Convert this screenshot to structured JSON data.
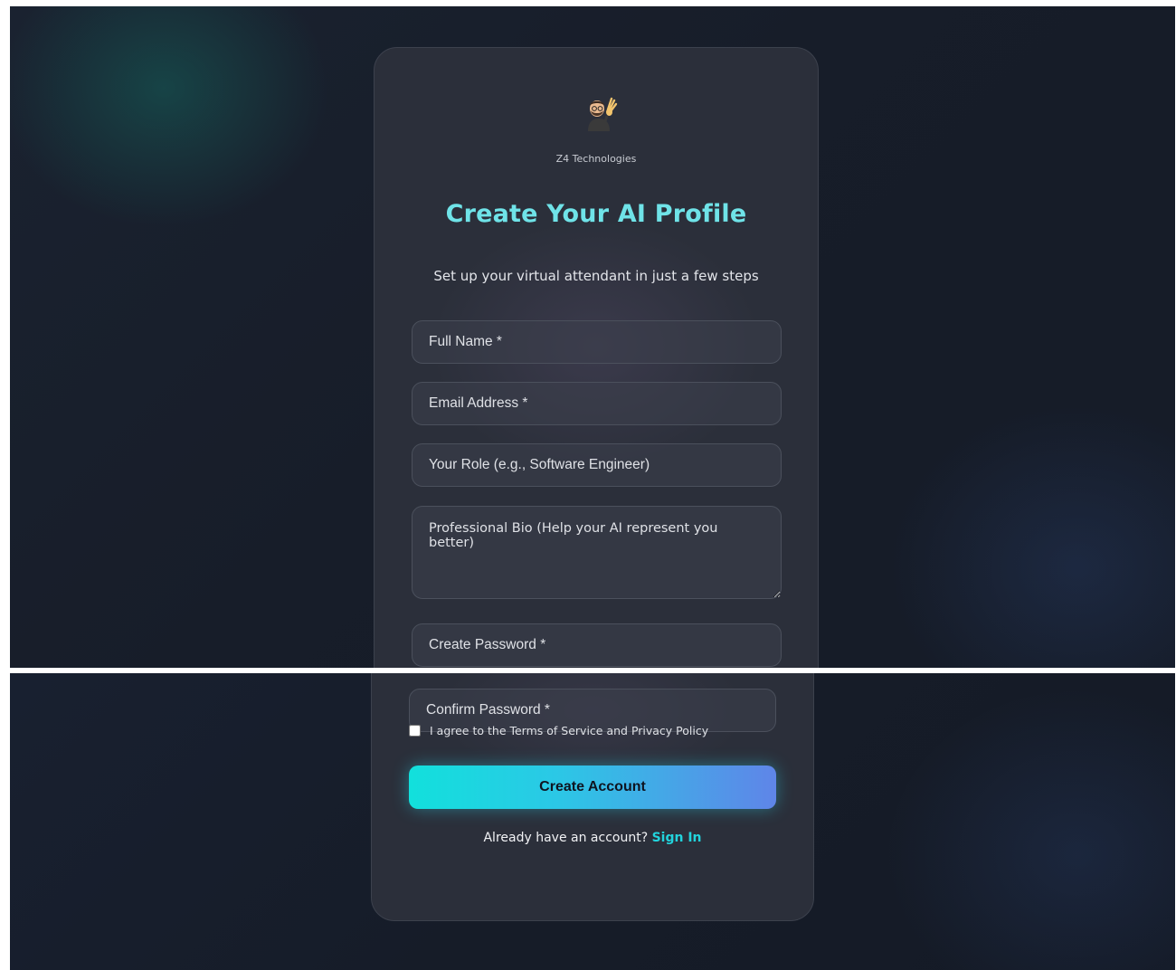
{
  "brand": {
    "company": "Z4 Technologies",
    "avatar_icon": "avatar-waving-icon"
  },
  "header": {
    "title": "Create Your AI Profile",
    "subtitle": "Set up your virtual attendant in just a few steps"
  },
  "form": {
    "full_name": {
      "value": "",
      "placeholder": "Full Name *"
    },
    "email": {
      "value": "",
      "placeholder": "Email Address *"
    },
    "role": {
      "value": "",
      "placeholder": "Your Role (e.g., Software Engineer)"
    },
    "bio": {
      "value": "",
      "placeholder": "Professional Bio (Help your AI represent you better)"
    },
    "password": {
      "value": "",
      "placeholder": "Create Password *"
    },
    "confirm_password": {
      "value": "",
      "placeholder": "Confirm Password *"
    },
    "terms": {
      "label": "I agree to the Terms of Service and Privacy Policy",
      "checked": false
    },
    "submit_label": "Create Account"
  },
  "footer": {
    "prompt": "Already have an account?",
    "link_label": "Sign In"
  },
  "colors": {
    "accent": "#22d3dc",
    "title": "#6fe3e8",
    "button_start": "#12e0dc",
    "button_end": "#5f85e8",
    "card_bg": "#2b2f3a",
    "page_bg": "#171d29"
  }
}
